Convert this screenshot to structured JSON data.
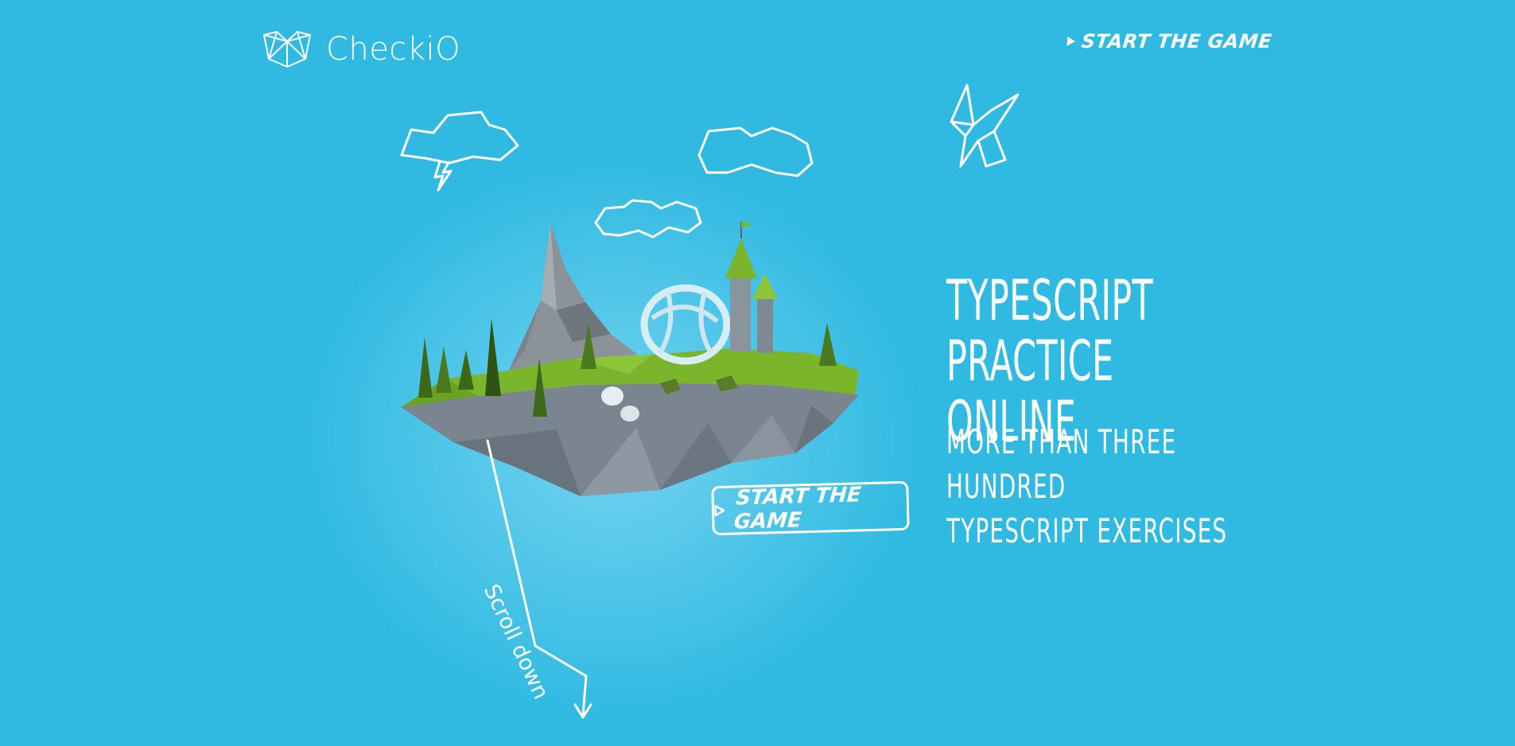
{
  "header": {
    "brand": "CheckiO",
    "start_link": "START THE GAME"
  },
  "hero": {
    "title_line1": "TYPESCRIPT PRACTICE",
    "title_line2": "ONLINE",
    "subtitle_line1": "MORE THAN THREE HUNDRED",
    "subtitle_line2": "TYPESCRIPT EXERCISES",
    "cta": "START THE GAME"
  },
  "scroll": {
    "label": "Scroll down"
  },
  "colors": {
    "background": "#30bae2",
    "foreground": "#ffffff",
    "grass": "#7ab52c",
    "rock": "#7f8a93"
  },
  "icons": [
    "checkio-logo-icon",
    "play-icon",
    "cloud-icon",
    "storm-cloud-icon",
    "origami-bird-icon",
    "arrow-down-icon"
  ]
}
